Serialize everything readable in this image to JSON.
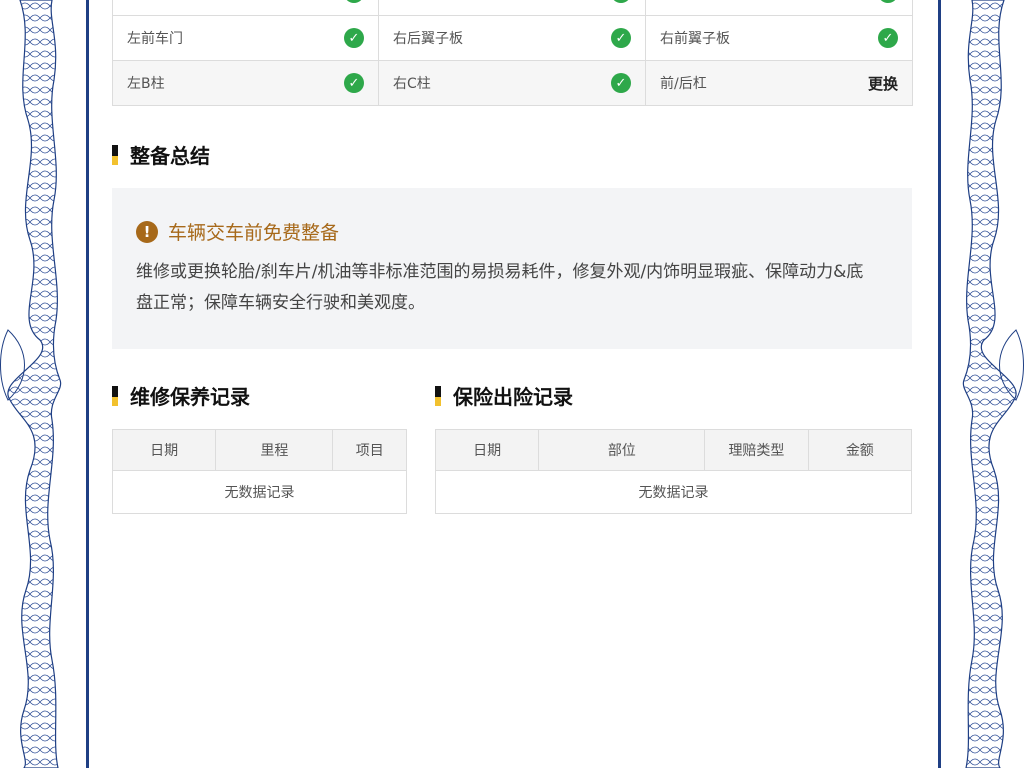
{
  "inspection_grid": {
    "rows": [
      {
        "cells": [
          {
            "label": "",
            "status": "check"
          },
          {
            "label": "",
            "status": "check"
          },
          {
            "label": "",
            "status": "check"
          }
        ]
      },
      {
        "cells": [
          {
            "label": "左前车门",
            "status": "check"
          },
          {
            "label": "右后翼子板",
            "status": "check"
          },
          {
            "label": "右前翼子板",
            "status": "check"
          }
        ]
      },
      {
        "cells": [
          {
            "label": "左B柱",
            "status": "check"
          },
          {
            "label": "右C柱",
            "status": "check"
          },
          {
            "label": "前/后杠",
            "status": "text",
            "status_text": "更换"
          }
        ]
      }
    ],
    "check_color": "#2ea84a"
  },
  "summary_section": {
    "title": "整备总结",
    "notice_icon": "exclamation-circle-icon",
    "notice_title": "车辆交车前免费整备",
    "notice_text": "维修或更换轮胎/刹车片/机油等非标准范围的易损易耗件，修复外观/内饰明显瑕疵、保障动力&底盘正常；保障车辆安全行驶和美观度。",
    "accent_color": "#a7691a"
  },
  "maintenance_section": {
    "title": "维修保养记录",
    "columns": [
      "日期",
      "里程",
      "项目"
    ],
    "empty_text": "无数据记录"
  },
  "insurance_section": {
    "title": "保险出险记录",
    "columns": [
      "日期",
      "部位",
      "理赔类型",
      "金额"
    ],
    "empty_text": "无数据记录"
  },
  "colors": {
    "frame_blue": "#1f3f84",
    "title_marker_yellow": "#f2c12e"
  }
}
